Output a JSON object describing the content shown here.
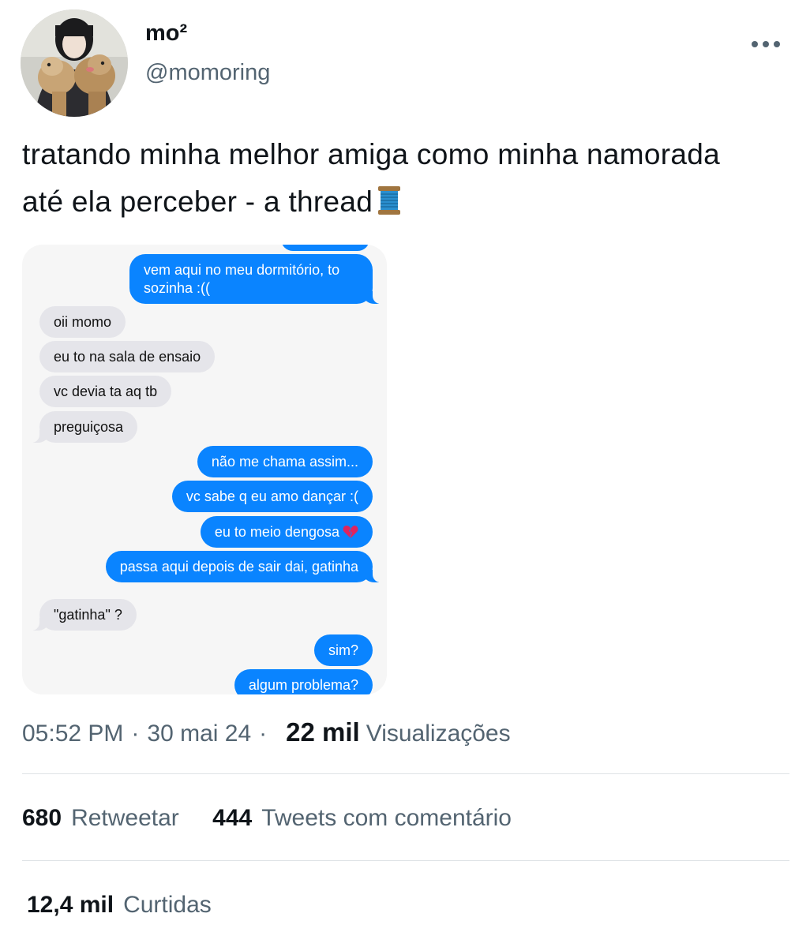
{
  "author": {
    "display_name": "mo²",
    "handle": "@momoring"
  },
  "tweet": {
    "text_line1": "tratando minha melhor amiga como minha namorada",
    "text_line2": "até ela perceber - a thread",
    "emoji_icon": "spool-of-thread-icon"
  },
  "chat": {
    "outgoing_color": "#0a84ff",
    "incoming_color": "#e5e5ea",
    "messages": [
      {
        "from": "me",
        "text": "vem aqui no meu dormitório, to"
      },
      {
        "from": "me",
        "text": "sozinha :(("
      },
      {
        "from": "friend",
        "text": "oii momo"
      },
      {
        "from": "friend",
        "text": "eu to na sala de ensaio"
      },
      {
        "from": "friend",
        "text": "vc devia ta aq tb"
      },
      {
        "from": "friend",
        "text": "preguiçosa"
      },
      {
        "from": "me",
        "text": "não me chama assim..."
      },
      {
        "from": "me",
        "text": "vc sabe q eu amo dançar :("
      },
      {
        "from": "me",
        "text": "eu to meio dengosa"
      },
      {
        "from": "me",
        "text": "passa aqui depois de sair dai, gatinha"
      },
      {
        "from": "friend",
        "text": "\"gatinha\" ?"
      },
      {
        "from": "me",
        "text": "sim?"
      },
      {
        "from": "me",
        "text": "algum problema?"
      }
    ]
  },
  "meta": {
    "time": "05:52 PM",
    "separator": "·",
    "date": "30 mai 24",
    "views_count": "22 mil",
    "views_label": "Visualizações"
  },
  "stats": {
    "retweets_count": "680",
    "retweets_label": "Retweetar",
    "quotes_count": "444",
    "quotes_label": "Tweets com comentário",
    "likes_count": "12,4 mil",
    "likes_label": "Curtidas"
  }
}
